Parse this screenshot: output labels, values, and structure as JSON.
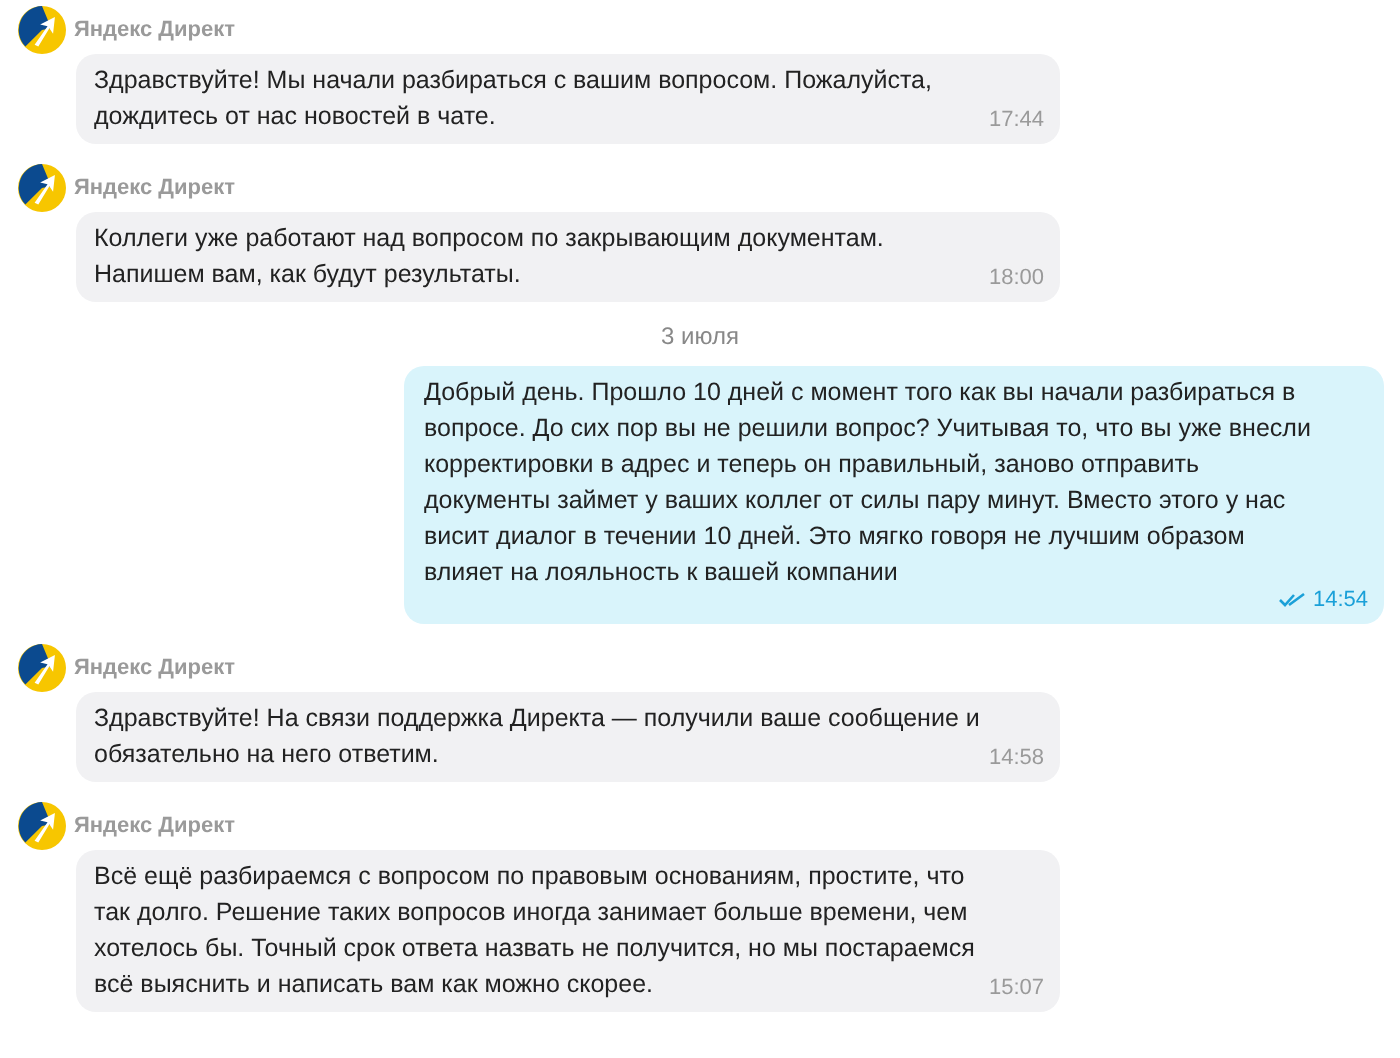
{
  "messages": [
    {
      "kind": "incoming",
      "sender": "Яндекс Директ",
      "text": "Здравствуйте! Мы начали разбираться с вашим вопросом. Пожалуйста,\nдождитесь от нас новостей в чате.",
      "time": "17:44"
    },
    {
      "kind": "incoming",
      "sender": "Яндекс Директ",
      "text": "Коллеги уже работают над вопросом по закрывающим документам.\nНапишем вам, как будут результаты.",
      "time": "18:00"
    },
    {
      "kind": "date",
      "text": "3 июля"
    },
    {
      "kind": "outgoing",
      "text": "Добрый день. Прошло 10 дней с момент того как вы начали разбираться в\nвопросе. До сих пор вы не решили вопрос? Учитывая то, что вы уже внесли\nкорректировки в адрес и теперь он правильный, заново отправить\nдокументы займет у ваших коллег от силы пару минут. Вместо этого у нас\nвисит диалог в течении 10 дней. Это мягко говоря не лучшим образом\nвлияет на лояльность к вашей компании",
      "time": "14:54",
      "read": true
    },
    {
      "kind": "incoming",
      "sender": "Яндекс Директ",
      "text": "Здравствуйте! На связи поддержка Директа — получили ваше сообщение и\nобязательно на него ответим.",
      "time": "14:58"
    },
    {
      "kind": "incoming",
      "sender": "Яндекс Директ",
      "text": "Всё ещё разбираемся с вопросом по правовым основаниям, простите, что\nтак долго. Решение таких вопросов иногда занимает больше времени, чем\nхотелось бы. Точный срок ответа назвать не получится, но мы постараемся\nвсё выяснить и написать вам как можно скорее.",
      "time": "15:07"
    }
  ]
}
